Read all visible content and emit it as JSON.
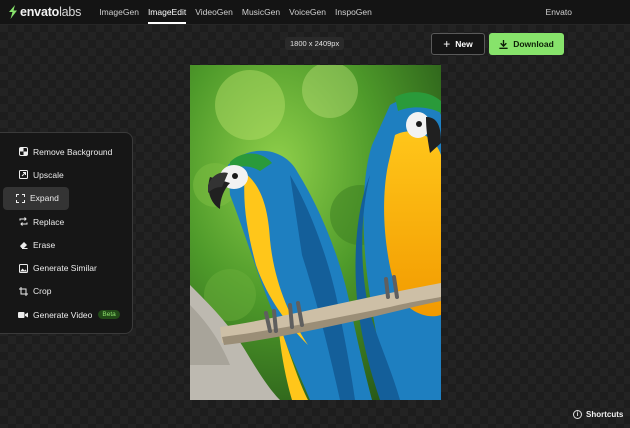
{
  "brand": {
    "name": "envato",
    "suffix": "labs"
  },
  "nav": {
    "items": [
      {
        "label": "ImageGen",
        "active": false
      },
      {
        "label": "ImageEdit",
        "active": true
      },
      {
        "label": "VideoGen",
        "active": false
      },
      {
        "label": "MusicGen",
        "active": false
      },
      {
        "label": "VoiceGen",
        "active": false
      },
      {
        "label": "InspoGen",
        "active": false
      }
    ]
  },
  "account": {
    "label": "Envato"
  },
  "canvas": {
    "dimensions": "1800 x 2409px"
  },
  "actions": {
    "new_label": "New",
    "download_label": "Download"
  },
  "tools": {
    "items": [
      {
        "label": "Remove Background",
        "icon": "checkerboard-icon"
      },
      {
        "label": "Upscale",
        "icon": "upscale-icon"
      },
      {
        "label": "Expand",
        "icon": "expand-icon",
        "active": true
      },
      {
        "label": "Replace",
        "icon": "replace-icon"
      },
      {
        "label": "Erase",
        "icon": "eraser-icon"
      },
      {
        "label": "Generate Similar",
        "icon": "image-icon"
      },
      {
        "label": "Crop",
        "icon": "crop-icon"
      },
      {
        "label": "Generate Video",
        "icon": "video-icon",
        "badge": "Beta"
      }
    ]
  },
  "footer": {
    "shortcuts_label": "Shortcuts"
  },
  "colors": {
    "accent": "#87e36b",
    "background": "#1d1d1d",
    "topbar": "#141414"
  }
}
